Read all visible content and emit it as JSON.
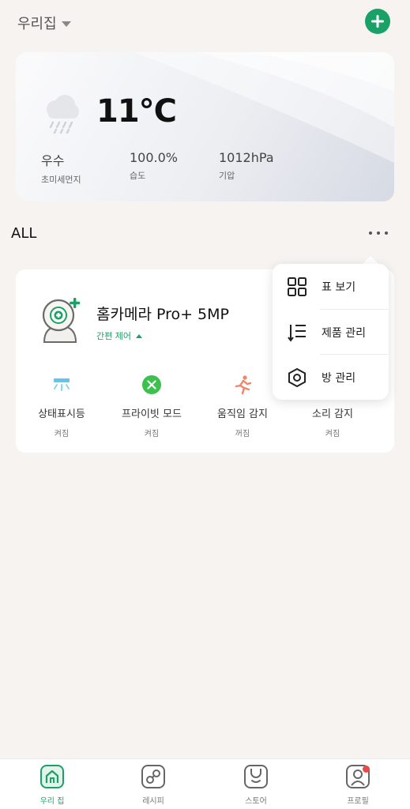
{
  "header": {
    "home_name": "우리집"
  },
  "weather": {
    "temperature": "11°C",
    "metrics": [
      {
        "value": "우수",
        "label": "초미세먼지"
      },
      {
        "value": "100.0%",
        "label": "습도"
      },
      {
        "value": "1012hPa",
        "label": "기압"
      }
    ]
  },
  "section": {
    "label": "ALL"
  },
  "device": {
    "name": "홈카메라 Pro+ 5MP",
    "quick_control": "간편 제어",
    "features": [
      {
        "name": "상태표시등",
        "state": "켜짐"
      },
      {
        "name": "프라이빗 모드",
        "state": "켜짐"
      },
      {
        "name": "움직임 감지",
        "state": "꺼짐"
      },
      {
        "name": "소리 감지",
        "state": "켜짐"
      }
    ]
  },
  "menu": {
    "items": [
      {
        "label": "표 보기"
      },
      {
        "label": "제품 관리"
      },
      {
        "label": "방 관리"
      }
    ]
  },
  "tabs": [
    {
      "label": "우리 집",
      "active": true
    },
    {
      "label": "레시피"
    },
    {
      "label": "스토어"
    },
    {
      "label": "프로필"
    }
  ],
  "colors": {
    "accent": "#1aa167",
    "background": "#f6f3f0",
    "badge": "#e84a4a"
  }
}
